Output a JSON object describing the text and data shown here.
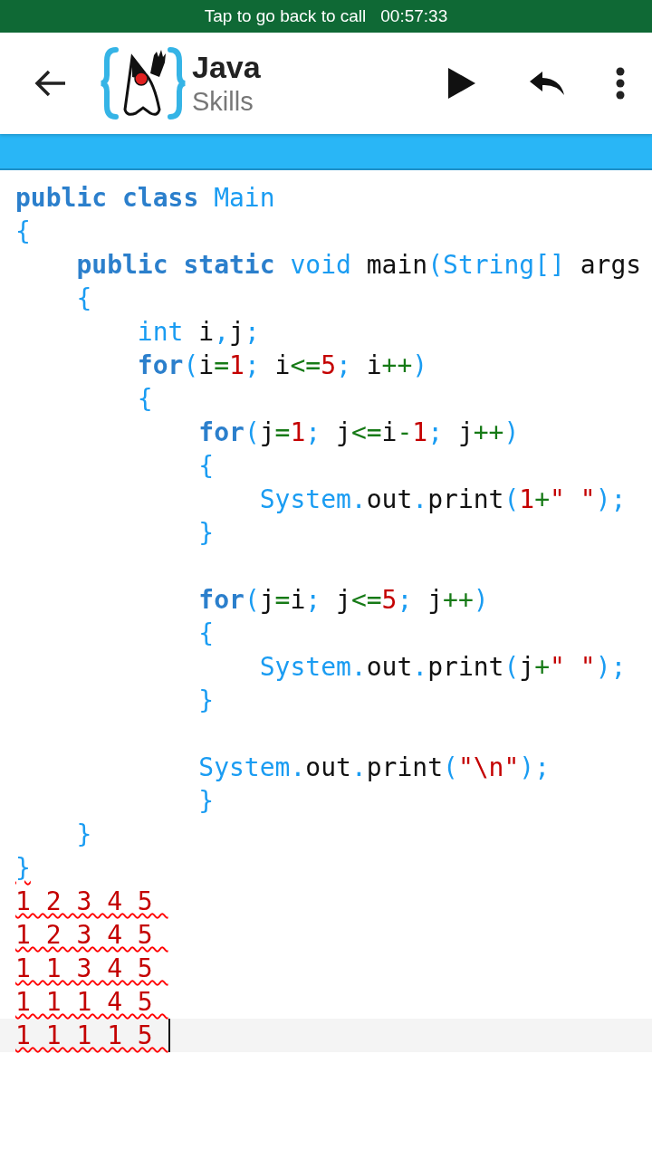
{
  "call_banner": {
    "text": "Tap to go back to call",
    "time": "00:57:33"
  },
  "toolbar": {
    "title": "Java",
    "subtitle": "Skills"
  },
  "code_lines": [
    {
      "tokens": [
        {
          "kind": "keyword",
          "text": "public class "
        },
        {
          "kind": "type",
          "text": "Main"
        }
      ]
    },
    {
      "tokens": [
        {
          "kind": "punct",
          "text": "{"
        }
      ]
    },
    {
      "tokens": [
        {
          "kind": "keyword",
          "text": "    public static "
        },
        {
          "kind": "type",
          "text": "void "
        },
        {
          "kind": "plain",
          "text": "main"
        },
        {
          "kind": "punct",
          "text": "(String[] "
        },
        {
          "kind": "plain",
          "text": "args"
        }
      ]
    },
    {
      "tokens": [
        {
          "kind": "punct",
          "text": "    {"
        }
      ]
    },
    {
      "tokens": [
        {
          "kind": "type",
          "text": "        int "
        },
        {
          "kind": "plain",
          "text": "i"
        },
        {
          "kind": "punct",
          "text": ","
        },
        {
          "kind": "plain",
          "text": "j"
        },
        {
          "kind": "punct",
          "text": ";"
        }
      ]
    },
    {
      "tokens": [
        {
          "kind": "keyword",
          "text": "        for"
        },
        {
          "kind": "punct",
          "text": "("
        },
        {
          "kind": "plain",
          "text": "i"
        },
        {
          "kind": "operator",
          "text": "="
        },
        {
          "kind": "number",
          "text": "1"
        },
        {
          "kind": "punct",
          "text": "; "
        },
        {
          "kind": "plain",
          "text": "i"
        },
        {
          "kind": "operator",
          "text": "<="
        },
        {
          "kind": "number",
          "text": "5"
        },
        {
          "kind": "punct",
          "text": "; "
        },
        {
          "kind": "plain",
          "text": "i"
        },
        {
          "kind": "operator",
          "text": "++"
        },
        {
          "kind": "punct",
          "text": ")"
        }
      ]
    },
    {
      "tokens": [
        {
          "kind": "punct",
          "text": "        {"
        }
      ]
    },
    {
      "tokens": [
        {
          "kind": "keyword",
          "text": "            for"
        },
        {
          "kind": "punct",
          "text": "("
        },
        {
          "kind": "plain",
          "text": "j"
        },
        {
          "kind": "operator",
          "text": "="
        },
        {
          "kind": "number",
          "text": "1"
        },
        {
          "kind": "punct",
          "text": "; "
        },
        {
          "kind": "plain",
          "text": "j"
        },
        {
          "kind": "operator",
          "text": "<="
        },
        {
          "kind": "plain",
          "text": "i"
        },
        {
          "kind": "operator",
          "text": "-"
        },
        {
          "kind": "number",
          "text": "1"
        },
        {
          "kind": "punct",
          "text": "; "
        },
        {
          "kind": "plain",
          "text": "j"
        },
        {
          "kind": "operator",
          "text": "++"
        },
        {
          "kind": "punct",
          "text": ")"
        }
      ]
    },
    {
      "tokens": [
        {
          "kind": "punct",
          "text": "            {"
        }
      ]
    },
    {
      "tokens": [
        {
          "kind": "type",
          "text": "                System."
        },
        {
          "kind": "plain",
          "text": "out"
        },
        {
          "kind": "punct",
          "text": "."
        },
        {
          "kind": "plain",
          "text": "print"
        },
        {
          "kind": "punct",
          "text": "("
        },
        {
          "kind": "number",
          "text": "1"
        },
        {
          "kind": "operator",
          "text": "+"
        },
        {
          "kind": "number",
          "text": "\" \""
        },
        {
          "kind": "punct",
          "text": ");"
        }
      ]
    },
    {
      "tokens": [
        {
          "kind": "punct",
          "text": "            }"
        }
      ]
    },
    {
      "misspelled": false,
      "current": false
    },
    {
      "tokens": [
        {
          "kind": "keyword",
          "text": "            for"
        },
        {
          "kind": "punct",
          "text": "("
        },
        {
          "kind": "plain",
          "text": "j"
        },
        {
          "kind": "operator",
          "text": "="
        },
        {
          "kind": "plain",
          "text": "i"
        },
        {
          "kind": "punct",
          "text": "; "
        },
        {
          "kind": "plain",
          "text": "j"
        },
        {
          "kind": "operator",
          "text": "<="
        },
        {
          "kind": "number",
          "text": "5"
        },
        {
          "kind": "punct",
          "text": "; "
        },
        {
          "kind": "plain",
          "text": "j"
        },
        {
          "kind": "operator",
          "text": "++"
        },
        {
          "kind": "punct",
          "text": ")"
        }
      ]
    },
    {
      "tokens": [
        {
          "kind": "punct",
          "text": "            {"
        }
      ]
    },
    {
      "tokens": [
        {
          "kind": "type",
          "text": "                System."
        },
        {
          "kind": "plain",
          "text": "out"
        },
        {
          "kind": "punct",
          "text": "."
        },
        {
          "kind": "plain",
          "text": "print"
        },
        {
          "kind": "punct",
          "text": "("
        },
        {
          "kind": "plain",
          "text": "j"
        },
        {
          "kind": "operator",
          "text": "+"
        },
        {
          "kind": "number",
          "text": "\" \""
        },
        {
          "kind": "punct",
          "text": ");"
        }
      ]
    },
    {
      "tokens": [
        {
          "kind": "punct",
          "text": "            }"
        }
      ]
    },
    {
      "misspelled": false,
      "current": false
    },
    {
      "tokens": [
        {
          "kind": "type",
          "text": "            System."
        },
        {
          "kind": "plain",
          "text": "out"
        },
        {
          "kind": "punct",
          "text": "."
        },
        {
          "kind": "plain",
          "text": "print"
        },
        {
          "kind": "punct",
          "text": "("
        },
        {
          "kind": "number",
          "text": "\"\\n\""
        },
        {
          "kind": "punct",
          "text": ");"
        }
      ]
    },
    {
      "tokens": [
        {
          "kind": "punct",
          "text": "            }"
        }
      ]
    },
    {
      "tokens": [
        {
          "kind": "punct",
          "text": "    }"
        }
      ]
    },
    {
      "misspelled": true,
      "tokens": [
        {
          "kind": "punct",
          "text": "}"
        }
      ]
    },
    {
      "misspelled": true,
      "tokens": [
        {
          "kind": "number",
          "text": "1 2 3 4 5 "
        }
      ]
    },
    {
      "misspelled": true,
      "tokens": [
        {
          "kind": "number",
          "text": "1 2 3 4 5 "
        }
      ]
    },
    {
      "misspelled": true,
      "tokens": [
        {
          "kind": "number",
          "text": "1 1 3 4 5 "
        }
      ]
    },
    {
      "misspelled": true,
      "tokens": [
        {
          "kind": "number",
          "text": "1 1 1 4 5 "
        }
      ]
    },
    {
      "misspelled": true,
      "current": true,
      "tokens": [
        {
          "kind": "number",
          "text": "1 1 1 1 5 "
        }
      ]
    }
  ]
}
